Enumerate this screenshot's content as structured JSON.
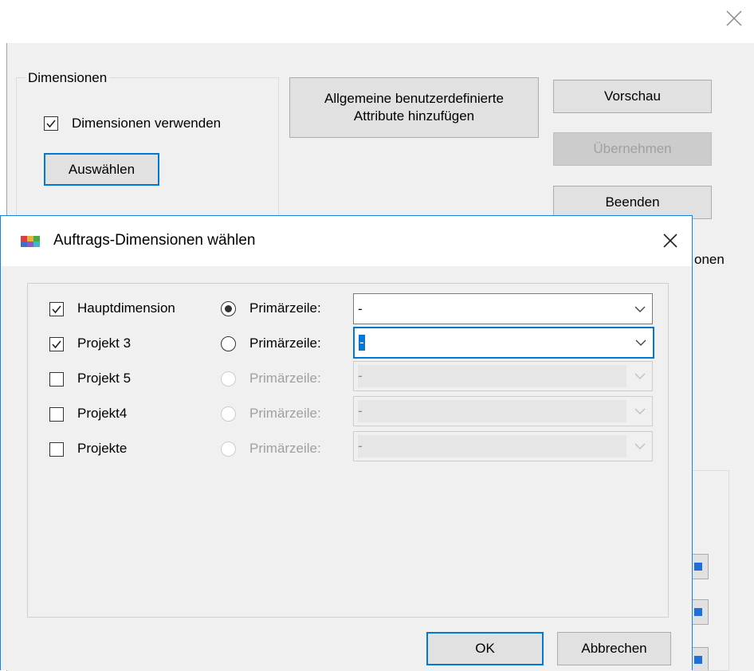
{
  "background_window": {
    "group_title": "Dimensionen",
    "use_dimensions_label": "Dimensionen verwenden",
    "use_dimensions_checked": true,
    "select_button": "Auswählen",
    "add_attributes_button_line1": "Allgemeine benutzerdefinierte",
    "add_attributes_button_line2": "Attribute hinzufügen",
    "preview_button": "Vorschau",
    "apply_button": "Übernehmen",
    "exit_button": "Beenden",
    "partial_label": "onen"
  },
  "dialog": {
    "title": "Auftrags-Dimensionen wählen",
    "rows": [
      {
        "name": "Hauptdimension",
        "checked": true,
        "radio_selected": true,
        "enabled": true,
        "radio_label": "Primärzeile:",
        "value": "-"
      },
      {
        "name": "Projekt 3",
        "checked": true,
        "radio_selected": false,
        "enabled": true,
        "radio_label": "Primärzeile:",
        "value": "-"
      },
      {
        "name": "Projekt 5",
        "checked": false,
        "radio_selected": false,
        "enabled": false,
        "radio_label": "Primärzeile:",
        "value": "-"
      },
      {
        "name": "Projekt4",
        "checked": false,
        "radio_selected": false,
        "enabled": false,
        "radio_label": "Primärzeile:",
        "value": "-"
      },
      {
        "name": "Projekte",
        "checked": false,
        "radio_selected": false,
        "enabled": false,
        "radio_label": "Primärzeile:",
        "value": "-"
      }
    ],
    "ok_button": "OK",
    "cancel_button": "Abbrechen"
  },
  "colors": {
    "accent": "#0078d7",
    "window_bg": "#f0f0f0",
    "disabled_text": "#a0a0a0"
  },
  "icons": {
    "dialog_app_icon": "dimensions-app-icon",
    "close": "close-icon",
    "checkmark": "checkmark-icon",
    "dropdown": "chevron-down-icon"
  }
}
